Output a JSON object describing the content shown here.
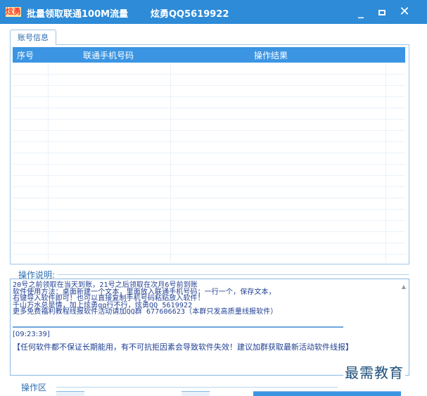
{
  "window": {
    "icon_text": "炫勇",
    "title": "批量领取联通100M流量",
    "author": "炫勇QQ5619922",
    "controls": {
      "minimize": "_",
      "close": "✕"
    }
  },
  "tabs": [
    {
      "label": "账号信息"
    }
  ],
  "table": {
    "columns": [
      "序号",
      "联通手机号码",
      "操作结果"
    ],
    "rows": []
  },
  "description": {
    "title": "操作说明:",
    "lines": [
      "20号之前领取在当天到账，21号之后领取在次月6号前到账",
      "软件使用方法：桌面新建一个文本，里面放入联通手机号码；一行一个，保存文本，",
      "右键导入软件即可！也可以直接复制手机号码粘贴放入软件！",
      "千山万水总是情，加上炫勇qq行不行，炫勇QQ 5619922",
      "更多免费福利教程线报软件活动请加QQ群 677606623（本群只发高质量线报软件）"
    ],
    "log_time": "[09:23:39]",
    "log_message": "【任何软件都不保证长期能用，有不可抗拒因素会导致软件失效！建议加群获取最新活动软件线报】"
  },
  "operation_area": {
    "title": "操作区"
  },
  "watermark": "最需教育"
}
